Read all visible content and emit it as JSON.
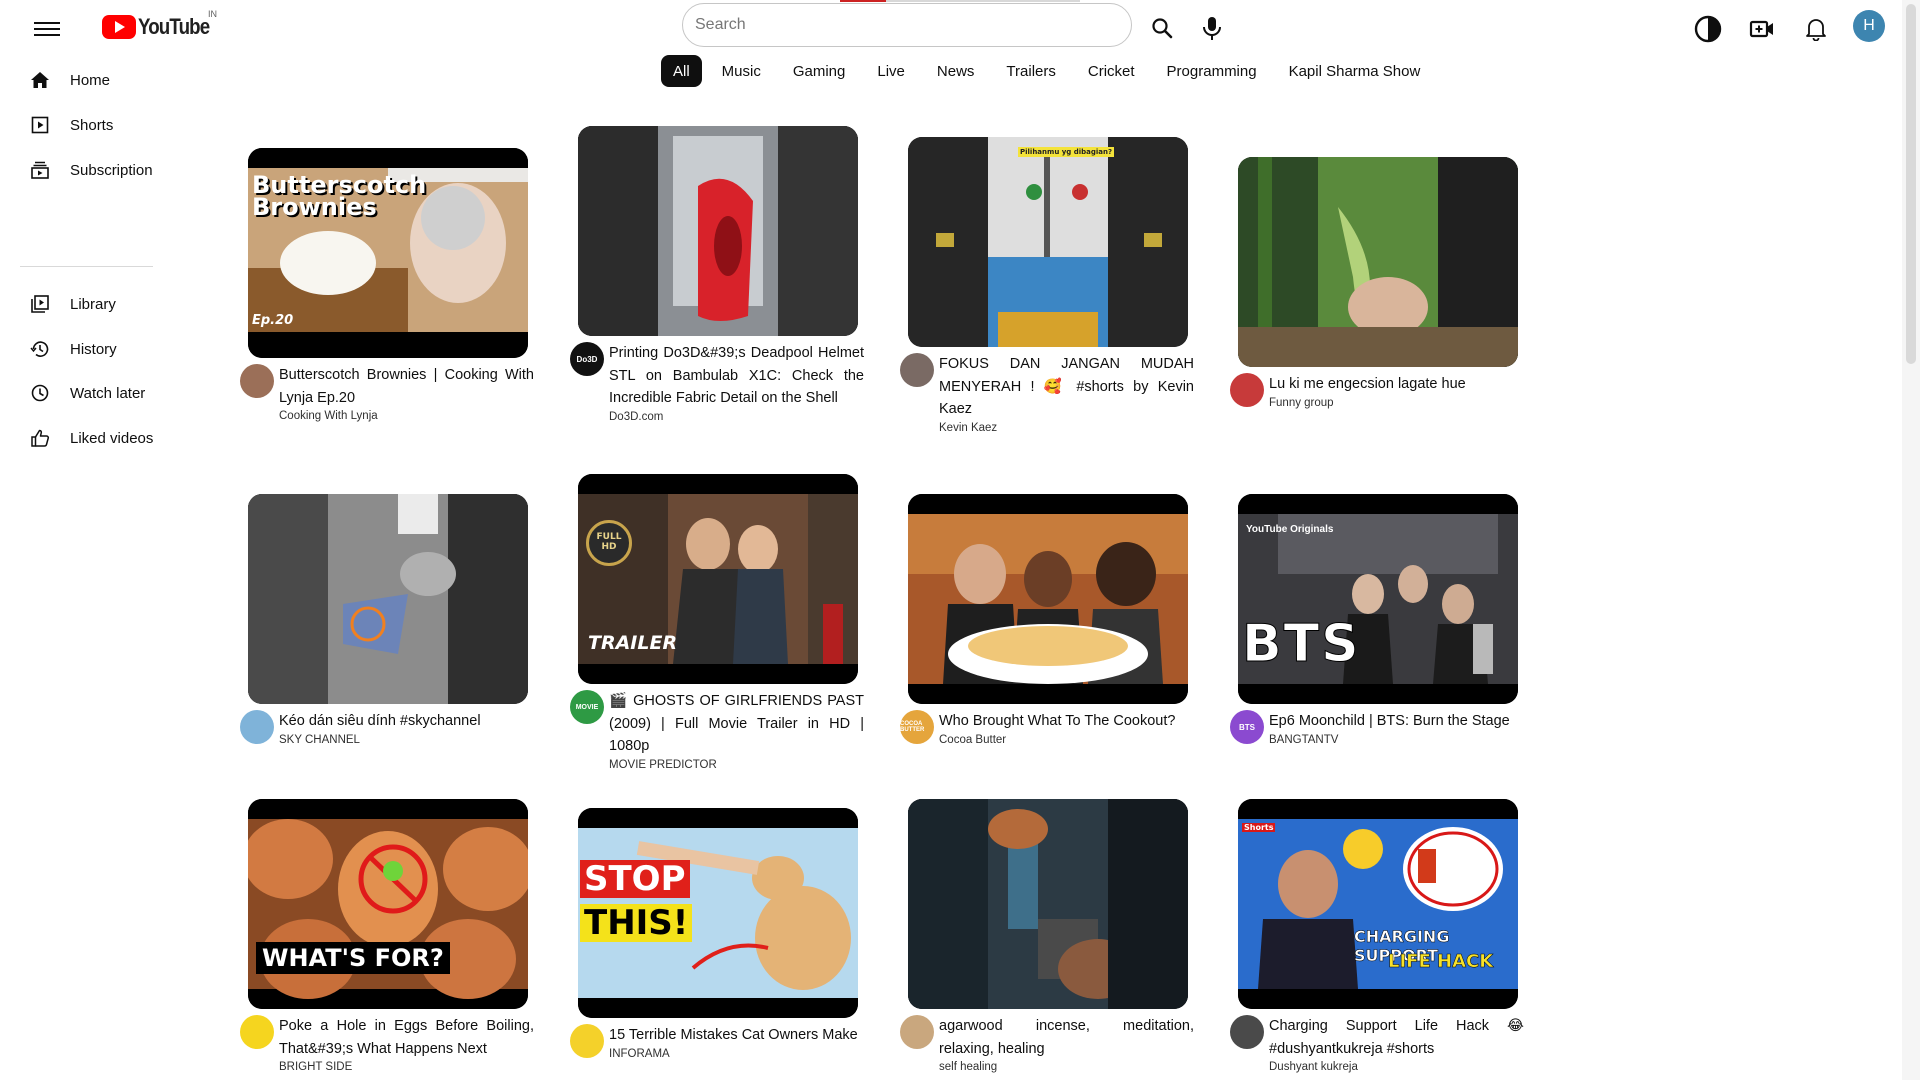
{
  "header": {
    "logo_text": "YouTube",
    "country": "IN",
    "search_placeholder": "Search",
    "avatar_letter": "H"
  },
  "chips": [
    "All",
    "Music",
    "Gaming",
    "Live",
    "News",
    "Trailers",
    "Cricket",
    "Programming",
    "Kapil Sharma Show"
  ],
  "sidebar": {
    "items": [
      {
        "label": "Home",
        "icon": "home-icon"
      },
      {
        "label": "Shorts",
        "icon": "shorts-icon"
      },
      {
        "label": "Subscription",
        "icon": "subscriptions-icon"
      },
      {
        "label": "Library",
        "icon": "library-icon"
      },
      {
        "label": "History",
        "icon": "history-icon"
      },
      {
        "label": "Watch later",
        "icon": "watch-later-icon"
      },
      {
        "label": "Liked videos",
        "icon": "liked-videos-icon"
      }
    ]
  },
  "videos": [
    {
      "title": "Butterscotch Brownies | Cooking With Lynja Ep.20",
      "channel": "Cooking With Lynja",
      "thumb_text": "Butterscotch Brownies",
      "thumb_sub": "Ep.20"
    },
    {
      "title": "Printing Do3D&#39;s Deadpool Helmet STL on Bambulab X1C: Check the Incredible Fabric Detail on the Shell",
      "channel": "Do3D.com",
      "avatar_text": "Do3D"
    },
    {
      "title": "FOKUS DAN JANGAN MUDAH MENYERAH ! 🥰 #shorts by Kevin Kaez",
      "channel": "Kevin Kaez",
      "thumb_text": "Pilihanmu yg dibagian?"
    },
    {
      "title": "Lu ki me engecsion lagate hue",
      "channel": "Funny group"
    },
    {
      "title": "Kéo dán siêu dính #skychannel",
      "channel": "SKY CHANNEL"
    },
    {
      "title": "🎬 GHOSTS OF GIRLFRIENDS PAST (2009) | Full Movie Trailer in HD | 1080p",
      "channel": "MOVIE PREDICTOR",
      "thumb_text": "TRAILER",
      "badge": "FULL HD",
      "avatar_text": "MOVIE"
    },
    {
      "title": "Who Brought What To The Cookout?",
      "channel": "Cocoa Butter",
      "avatar_text": "COCOA BUTTER"
    },
    {
      "title": "Ep6 Moonchild | BTS: Burn the Stage",
      "channel": "BANGTANTV",
      "thumb_text": "BTS",
      "thumb_sub": "YouTube Originals",
      "avatar_text": "BTS"
    },
    {
      "title": "Poke a Hole in Eggs Before Boiling, That&#39;s What Happens Next",
      "channel": "BRIGHT SIDE",
      "thumb_text": "WHAT'S FOR?"
    },
    {
      "title": "15 Terrible Mistakes Cat Owners Make",
      "channel": "INFORAMA",
      "thumb_text": "STOP",
      "thumb_sub": "THIS!"
    },
    {
      "title": "agarwood incense, meditation, relaxing, healing",
      "channel": "self healing"
    },
    {
      "title": "Charging Support Life Hack 😂 #dushyantkukreja #shorts",
      "channel": "Dushyant kukreja",
      "thumb_text": "CHARGING SUPPORT",
      "thumb_sub": "LIFE HACK",
      "badge": "Shorts"
    }
  ],
  "colors": {
    "brand_red": "#ff0000",
    "text_primary": "#0f0f0f",
    "chip_active_bg": "#0f0f0f",
    "avatar_bg": "#3d85b0"
  }
}
